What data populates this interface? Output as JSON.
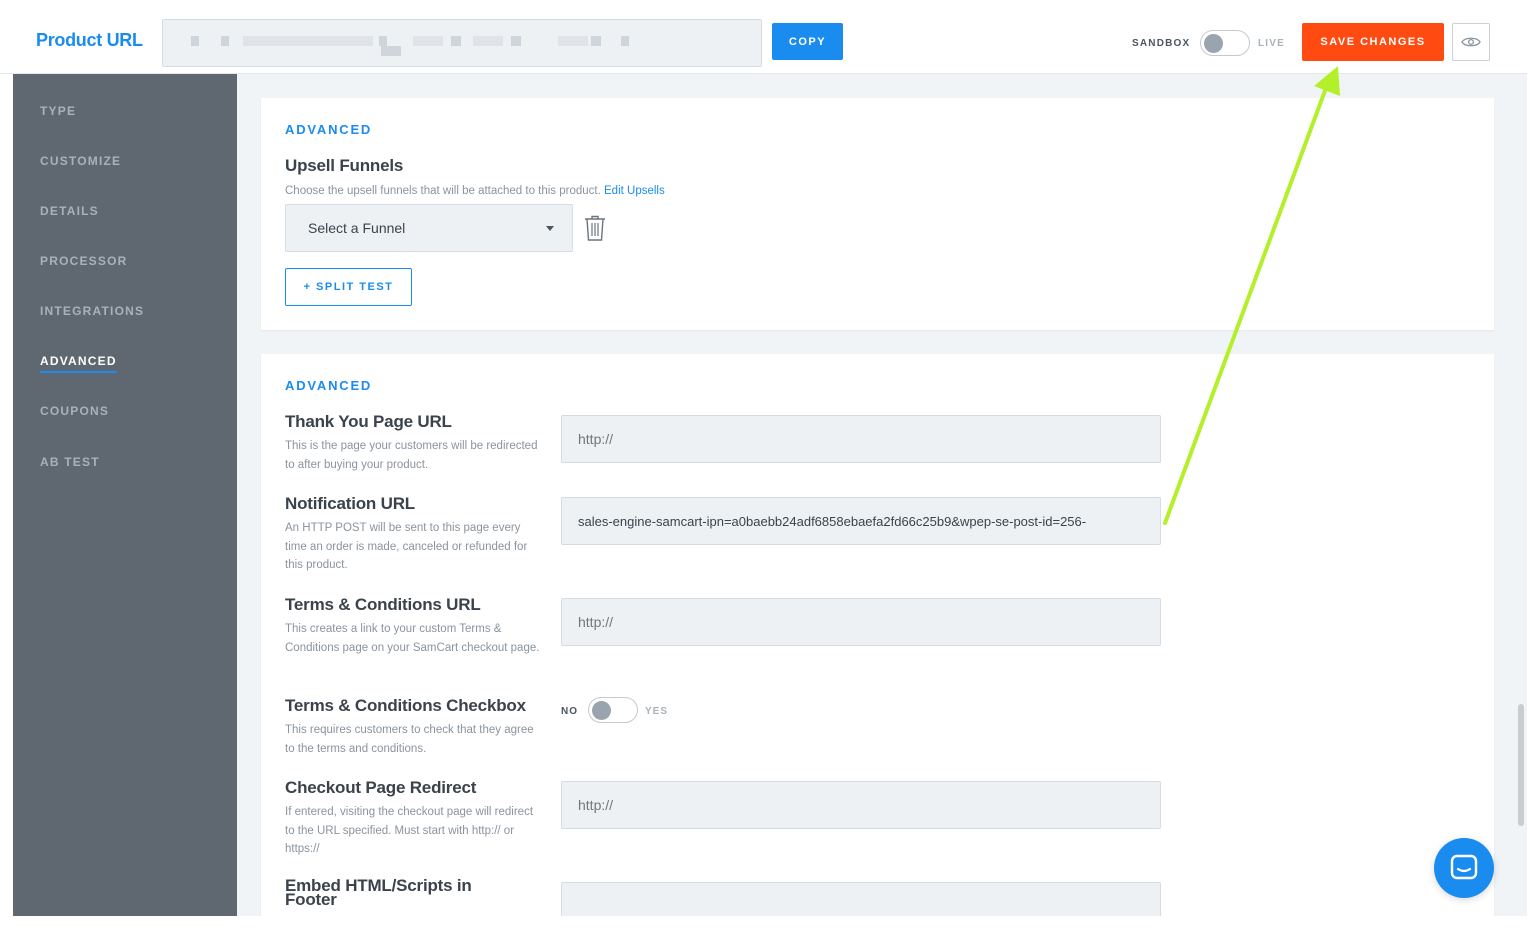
{
  "header": {
    "brand": "Product URL",
    "copy_label": "COPY",
    "sandbox_label": "SANDBOX",
    "live_label": "LIVE",
    "save_label": "SAVE CHANGES",
    "preview_icon": "eye-icon"
  },
  "sidebar": {
    "items": [
      {
        "label": "TYPE"
      },
      {
        "label": "CUSTOMIZE"
      },
      {
        "label": "DETAILS"
      },
      {
        "label": "PROCESSOR"
      },
      {
        "label": "INTEGRATIONS"
      },
      {
        "label": "ADVANCED"
      },
      {
        "label": "COUPONS"
      },
      {
        "label": "AB TEST"
      }
    ],
    "active": "ADVANCED"
  },
  "upsell": {
    "section": "ADVANCED",
    "title": "Upsell Funnels",
    "desc": "Choose the upsell funnels that will be attached to this product.",
    "link": "Edit Upsells",
    "select_value": "Select a Funnel",
    "split_label": "+ SPLIT TEST"
  },
  "advanced": {
    "section": "ADVANCED",
    "thank_you": {
      "title": "Thank You Page URL",
      "desc": "This is the page your customers will be redirected to after buying your product.",
      "placeholder": "http://"
    },
    "notification": {
      "title": "Notification URL",
      "desc": "An HTTP POST will be sent to this page every time an order is made, canceled or refunded for this product.",
      "value": "-sales-engine-samcart-ipn=a0baebb24adf6858ebaefa2fd66c25b9&wpep-se-post-id=256"
    },
    "terms_url": {
      "title": "Terms & Conditions URL",
      "desc": "This creates a link to your custom Terms & Conditions page on your SamCart checkout page.",
      "placeholder": "http://"
    },
    "terms_checkbox": {
      "title": "Terms & Conditions Checkbox",
      "desc": "This requires customers to check that they agree to the terms and conditions.",
      "no_label": "NO",
      "yes_label": "YES"
    },
    "redirect": {
      "title": "Checkout Page Redirect",
      "desc": "If entered, visiting the checkout page will redirect to the URL specified. Must start with http:// or https://",
      "placeholder": "http://"
    },
    "embed": {
      "title": "Embed HTML/Scripts in Footer"
    }
  },
  "colors": {
    "accent": "#1a8cf0",
    "save": "#ff4b12",
    "sidebar": "#5f6870",
    "annotation_arrow": "#b4f02a"
  }
}
